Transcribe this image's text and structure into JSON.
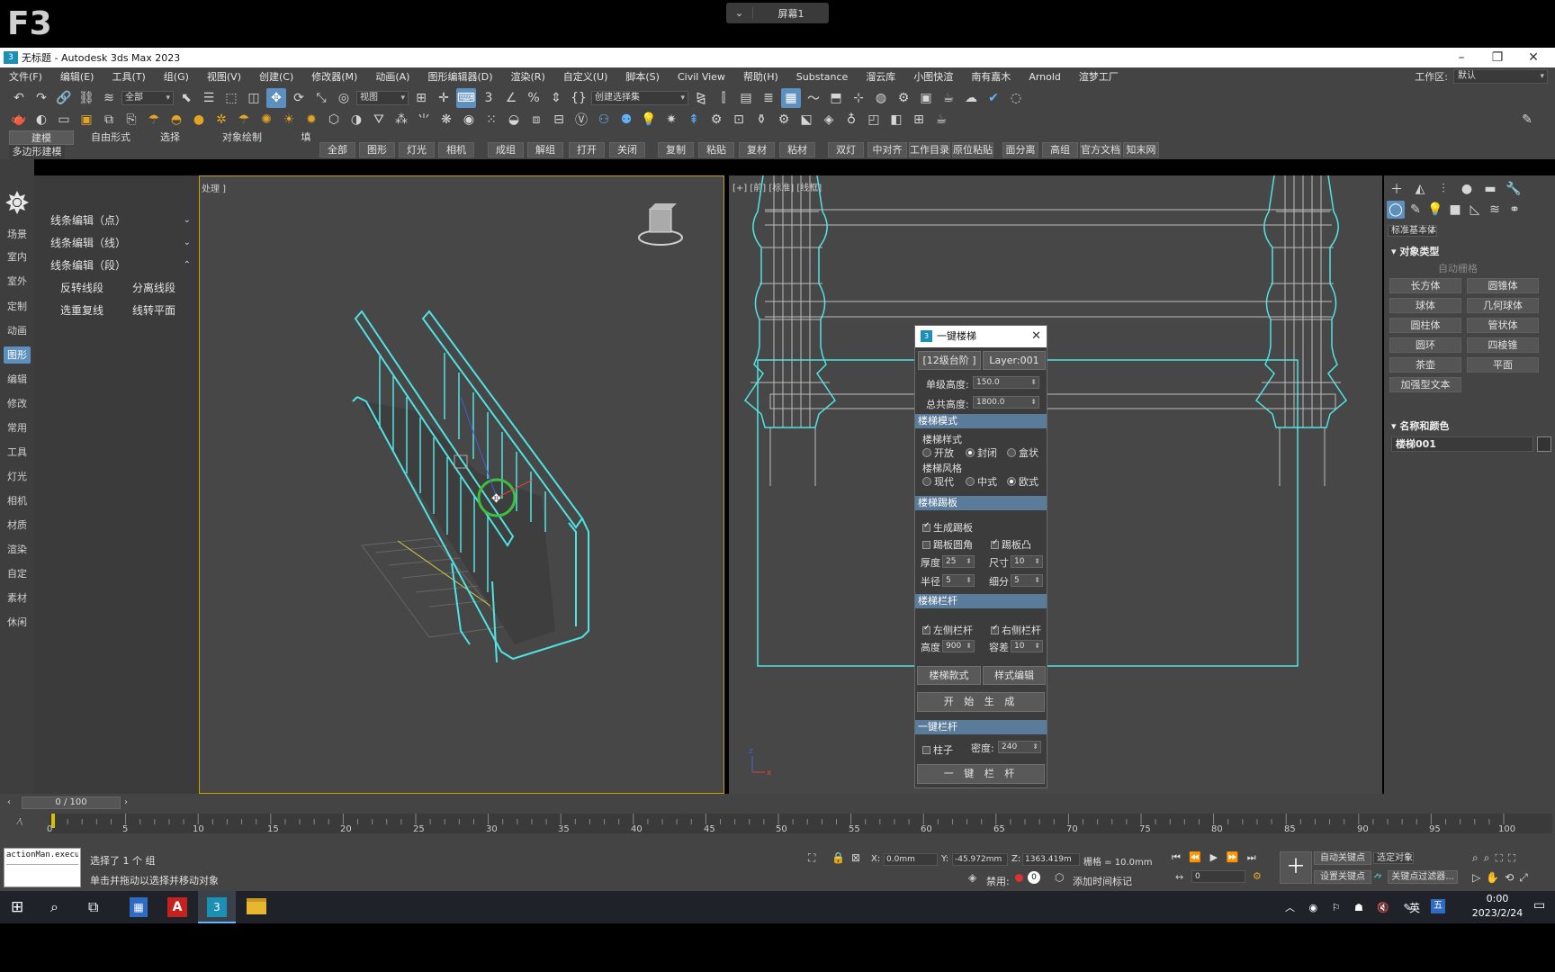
{
  "overlay": {
    "big_label": "F3",
    "screen_label": "屏幕1"
  },
  "window": {
    "title": "无标题 - Autodesk 3ds Max 2023"
  },
  "menu": [
    "文件(F)",
    "编辑(E)",
    "工具(T)",
    "组(G)",
    "视图(V)",
    "创建(C)",
    "修改器(M)",
    "动画(A)",
    "图形编辑器(D)",
    "渲染(R)",
    "自定义(U)",
    "脚本(S)",
    "Civil View",
    "帮助(H)",
    "Substance",
    "溜云库",
    "小图快渲",
    "南有嘉木",
    "Arnold",
    "渲梦工厂"
  ],
  "workspace": {
    "label": "工作区:",
    "value": "默认"
  },
  "toolbar": {
    "selection_filter": "全部",
    "ref_coord": "视图",
    "named_selection": "创建选择集"
  },
  "ribbon_tabs": [
    "建模",
    "自由形式",
    "选择",
    "对象绘制",
    "填"
  ],
  "ribbon_sub": "多边形建模",
  "quick_buttons": [
    "全部",
    "图形",
    "灯光",
    "相机",
    "成组",
    "解组",
    "打开",
    "关闭",
    "复制",
    "粘贴",
    "复材",
    "粘材",
    "双灯",
    "中对齐",
    "工作目录",
    "原位粘贴",
    "面分离",
    "高组",
    "官方文档",
    "知末网"
  ],
  "left_rail": [
    "场景",
    "室内",
    "室外",
    "定制",
    "动画",
    "图形",
    "编辑",
    "修改",
    "常用",
    "工具",
    "灯光",
    "相机",
    "材质",
    "渲染",
    "自定",
    "素材",
    "休闲"
  ],
  "left_rail_active": "图形",
  "spline_panel": {
    "rows": [
      "线条编辑（点）",
      "线条编辑（线）",
      "线条编辑（段）"
    ],
    "buttons": [
      "反转线段",
      "分离线段",
      "选重复线",
      "线转平面"
    ]
  },
  "viewport_left": {
    "label": "处理 ]"
  },
  "viewport_right": {
    "label": "[+] [前] [标准] [线框]"
  },
  "stair_dialog": {
    "title": "一键楼梯",
    "tag_steps": "[12级台阶 ]",
    "tag_layer": "Layer:001",
    "unit_height_label": "单级高度:",
    "unit_height_value": "150.0",
    "total_height_label": "总共高度:",
    "total_height_value": "1800.0",
    "sec_mode": "楼梯模式",
    "style_label": "楼梯样式",
    "style_options": [
      "开放",
      "封闭",
      "盒状"
    ],
    "style_selected": "封闭",
    "genre_label": "楼梯风格",
    "genre_options": [
      "现代",
      "中式",
      "欧式"
    ],
    "genre_selected": "欧式",
    "sec_skirt": "楼梯踢板",
    "gen_skirt": "生成踢板",
    "skirt_round": "踢板圆角",
    "skirt_bulge": "踢板凸",
    "thickness_label": "厚度",
    "thickness_value": "25",
    "size_label": "尺寸",
    "size_value": "10",
    "radius_label": "半径",
    "radius_value": "5",
    "segs_label": "细分",
    "segs_value": "5",
    "sec_rail": "楼梯栏杆",
    "left_rail": "左侧栏杆",
    "right_rail": "右侧栏杆",
    "height_label": "高度",
    "height_value": "900",
    "tol_label": "容差",
    "tol_value": "10",
    "btn_style": "楼梯款式",
    "btn_edit": "样式编辑",
    "btn_generate": "开 始 生 成",
    "sec_onekey": "一键栏杆",
    "post_label": "柱子",
    "density_label": "密度:",
    "density_value": "240",
    "btn_onekey": "一 键 栏 杆"
  },
  "command_panel": {
    "category": "标准基本体",
    "rollout_type": "对象类型",
    "autogrid": "自动栅格",
    "buttons": [
      "长方体",
      "圆锥体",
      "球体",
      "几何球体",
      "圆柱体",
      "管状体",
      "圆环",
      "四棱锥",
      "茶壶",
      "平面",
      "加强型文本"
    ],
    "rollout_name": "名称和颜色",
    "object_name": "楼梯001"
  },
  "timeline": {
    "frame": "0 / 100",
    "ticks": [
      "0",
      "5",
      "10",
      "15",
      "20",
      "25",
      "30",
      "35",
      "40",
      "45",
      "50",
      "55",
      "60",
      "65",
      "70",
      "75",
      "80",
      "85",
      "90",
      "95",
      "100"
    ]
  },
  "status": {
    "maxscript": "actionMan.execu",
    "selected": "选择了 1 个 组",
    "prompt": "单击并拖动以选择并移动对象",
    "x_label": "X:",
    "x": "0.0mm",
    "y_label": "Y:",
    "y": "-45.972mm",
    "z_label": "Z:",
    "z": "1363.419m",
    "grid": "栅格 = 10.0mm",
    "disabled": "禁用:",
    "add_tag": "添加时间标记",
    "autokey": "自动关键点",
    "setkey": "设置关键点",
    "selected_obj": "选定对象",
    "key_filter": "关键点过滤器...",
    "frame_field": "0"
  },
  "taskbar": {
    "time": "0:00",
    "date": "2023/2/24",
    "lang": "英"
  },
  "colors": {
    "accent": "#5d8fbf",
    "wire": "#4fe3e3",
    "viewport_border": "#c8a200"
  }
}
